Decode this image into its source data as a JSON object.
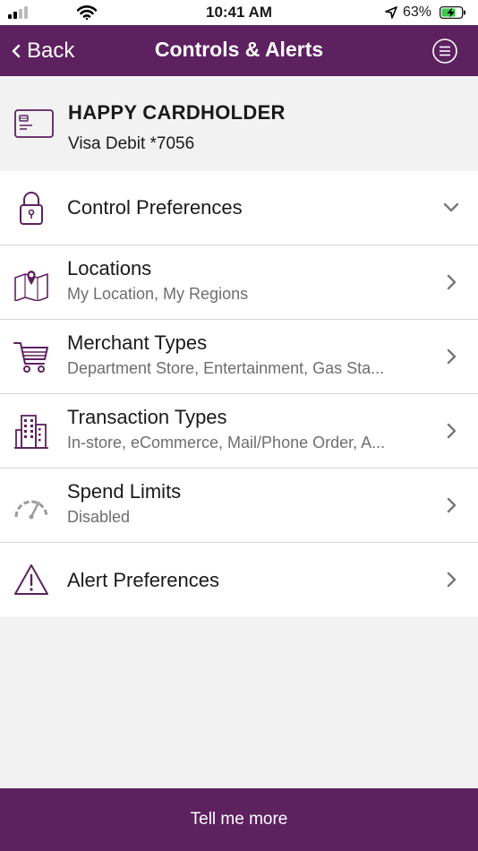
{
  "status_bar": {
    "time": "10:41 AM",
    "battery_percent": "63%",
    "icons": [
      "signal-icon",
      "wifi-icon",
      "location-arrow-icon",
      "battery-charging-icon"
    ]
  },
  "nav": {
    "back_label": "Back",
    "title": "Controls & Alerts",
    "back_icon": "chevron-left-icon",
    "menu_icon": "hamburger-menu-icon"
  },
  "card": {
    "name": "HAPPY CARDHOLDER",
    "number": "Visa Debit *7056",
    "icon": "credit-card-icon"
  },
  "rows": [
    {
      "title": "Control Preferences",
      "subtitle": "",
      "icon": "padlock-icon",
      "chevron": "chevron-down-icon"
    },
    {
      "title": "Locations",
      "subtitle": "My Location, My Regions",
      "icon": "map-pin-icon",
      "chevron": "chevron-right-icon"
    },
    {
      "title": "Merchant Types",
      "subtitle": "Department Store, Entertainment, Gas Sta...",
      "icon": "shopping-cart-icon",
      "chevron": "chevron-right-icon"
    },
    {
      "title": "Transaction Types",
      "subtitle": "In-store, eCommerce, Mail/Phone Order, A...",
      "icon": "buildings-icon",
      "chevron": "chevron-right-icon"
    },
    {
      "title": "Spend Limits",
      "subtitle": "Disabled",
      "icon": "speedometer-icon",
      "chevron": "chevron-right-icon"
    },
    {
      "title": "Alert Preferences",
      "subtitle": "",
      "icon": "warning-triangle-icon",
      "chevron": "chevron-right-icon"
    }
  ],
  "footer": {
    "tell_more_label": "Tell me more"
  },
  "colors": {
    "brand_purple": "#5d2160",
    "background": "#f2f2f2",
    "subtitle_gray": "#6e6e6e"
  }
}
